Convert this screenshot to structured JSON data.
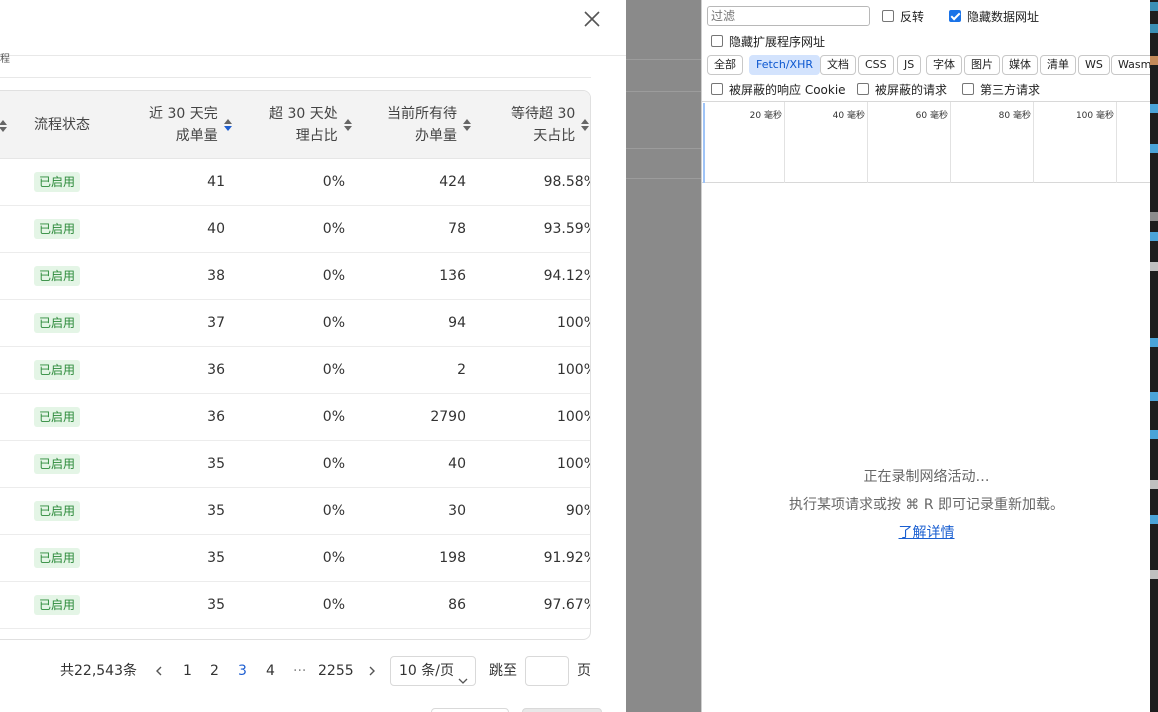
{
  "modal": {
    "subtitle_fragment": "程",
    "columns": [
      {
        "label": "流程状态"
      },
      {
        "label_line1": "近 30 天完",
        "label_line2": "成单量"
      },
      {
        "label_line1": "超 30 天处",
        "label_line2": "理占比"
      },
      {
        "label_line1": "当前所有待",
        "label_line2": "办单量"
      },
      {
        "label_line1": "等待超 30",
        "label_line2": "天占比"
      }
    ],
    "rows": [
      {
        "status": "已启用",
        "done_30d": "41",
        "over_30d_ratio": "0%",
        "pending": "424",
        "wait_ratio": "98.58%"
      },
      {
        "status": "已启用",
        "done_30d": "40",
        "over_30d_ratio": "0%",
        "pending": "78",
        "wait_ratio": "93.59%"
      },
      {
        "status": "已启用",
        "done_30d": "38",
        "over_30d_ratio": "0%",
        "pending": "136",
        "wait_ratio": "94.12%"
      },
      {
        "status": "已启用",
        "done_30d": "37",
        "over_30d_ratio": "0%",
        "pending": "94",
        "wait_ratio": "100%"
      },
      {
        "status": "已启用",
        "done_30d": "36",
        "over_30d_ratio": "0%",
        "pending": "2",
        "wait_ratio": "100%"
      },
      {
        "status": "已启用",
        "done_30d": "36",
        "over_30d_ratio": "0%",
        "pending": "2790",
        "wait_ratio": "100%"
      },
      {
        "status": "已启用",
        "done_30d": "35",
        "over_30d_ratio": "0%",
        "pending": "40",
        "wait_ratio": "100%"
      },
      {
        "status": "已启用",
        "done_30d": "35",
        "over_30d_ratio": "0%",
        "pending": "30",
        "wait_ratio": "90%"
      },
      {
        "status": "已启用",
        "done_30d": "35",
        "over_30d_ratio": "0%",
        "pending": "198",
        "wait_ratio": "91.92%"
      },
      {
        "status": "已启用",
        "done_30d": "35",
        "over_30d_ratio": "0%",
        "pending": "86",
        "wait_ratio": "97.67%"
      }
    ],
    "pagination": {
      "total": "共22,543条",
      "pages": [
        "1",
        "2",
        "3",
        "4"
      ],
      "current_page": "3",
      "ellipsis": "···",
      "last_page": "2255",
      "page_size": "10 条/页",
      "jump_label": "跳至",
      "jump_suffix": "页"
    },
    "colors": {
      "accent": "#1f5fd1",
      "badge_text": "#2c8a3a",
      "badge_bg": "#e4f5e6"
    }
  },
  "devtools": {
    "filter_placeholder": "过滤",
    "invert_label": "反转",
    "hide_data_urls_label": "隐藏数据网址",
    "hide_data_urls_checked": true,
    "hide_extension_urls_label": "隐藏扩展程序网址",
    "type_filters": [
      "全部",
      "Fetch/XHR",
      "文档",
      "CSS",
      "JS",
      "字体",
      "图片",
      "媒体",
      "清单",
      "WS",
      "Wasm"
    ],
    "selected_filter": "Fetch/XHR",
    "blocked_cookies_label": "被屏蔽的响应 Cookie",
    "blocked_requests_label": "被屏蔽的请求",
    "third_party_label": "第三方请求",
    "timeline_ticks": [
      "20 毫秒",
      "40 毫秒",
      "60 毫秒",
      "80 毫秒",
      "100 毫秒"
    ],
    "recording_text": "正在录制网络活动…",
    "hint_text": "执行某项请求或按 ⌘ R 即可记录重新加载。",
    "learn_more": "了解详情",
    "colors": {
      "selected_chip_bg": "#d3e3fd",
      "link": "#1a5fd1",
      "checkbox": "#1a73e8"
    }
  }
}
